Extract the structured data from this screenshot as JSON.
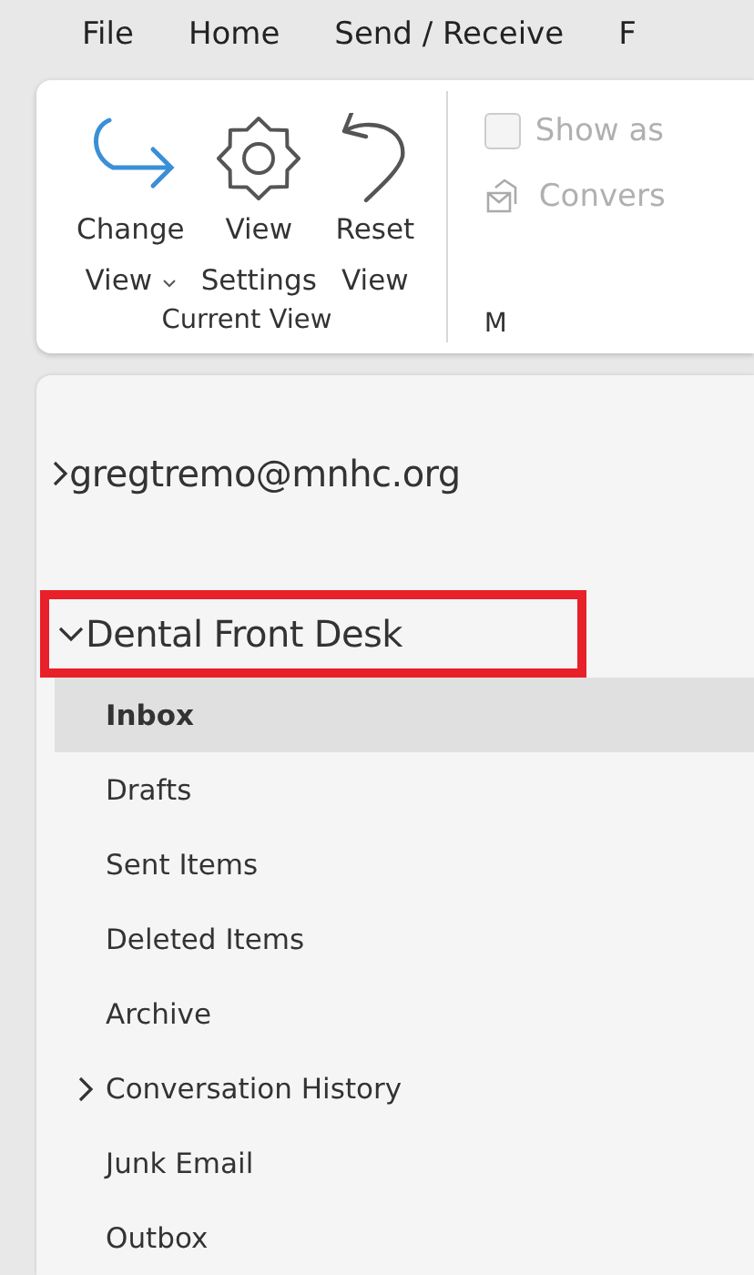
{
  "menu_tabs": [
    {
      "label": "File",
      "selected": false
    },
    {
      "label": "Home",
      "selected": false
    },
    {
      "label": "Send / Receive",
      "selected": false
    },
    {
      "label": "F",
      "selected": false
    }
  ],
  "ribbon": {
    "groups": [
      {
        "label": "Current View",
        "buttons": [
          {
            "kind": "change",
            "lines": [
              "Change",
              "View"
            ],
            "dropdown": true
          },
          {
            "kind": "settings",
            "lines": [
              "View",
              "Settings"
            ],
            "dropdown": false
          },
          {
            "kind": "reset",
            "lines": [
              "Reset",
              "View"
            ],
            "dropdown": false
          }
        ]
      },
      {
        "label": "M",
        "options": [
          {
            "kind": "checkbox",
            "label": "Show as",
            "checked": false,
            "disabled": true
          },
          {
            "kind": "envelope",
            "label": "Convers",
            "disabled": true
          }
        ]
      }
    ]
  },
  "accounts": [
    {
      "name": "gregtremo@mnhc.org",
      "expanded": false,
      "highlighted": false
    },
    {
      "name": "Dental Front Desk",
      "expanded": true,
      "highlighted": true,
      "folders": [
        {
          "label": "Inbox",
          "selected": true,
          "expandable": false
        },
        {
          "label": "Drafts",
          "selected": false,
          "expandable": false
        },
        {
          "label": "Sent Items",
          "selected": false,
          "expandable": false
        },
        {
          "label": "Deleted Items",
          "selected": false,
          "expandable": false
        },
        {
          "label": "Archive",
          "selected": false,
          "expandable": false
        },
        {
          "label": "Conversation History",
          "selected": false,
          "expandable": true
        },
        {
          "label": "Junk Email",
          "selected": false,
          "expandable": false
        },
        {
          "label": "Outbox",
          "selected": false,
          "expandable": false
        }
      ]
    }
  ]
}
